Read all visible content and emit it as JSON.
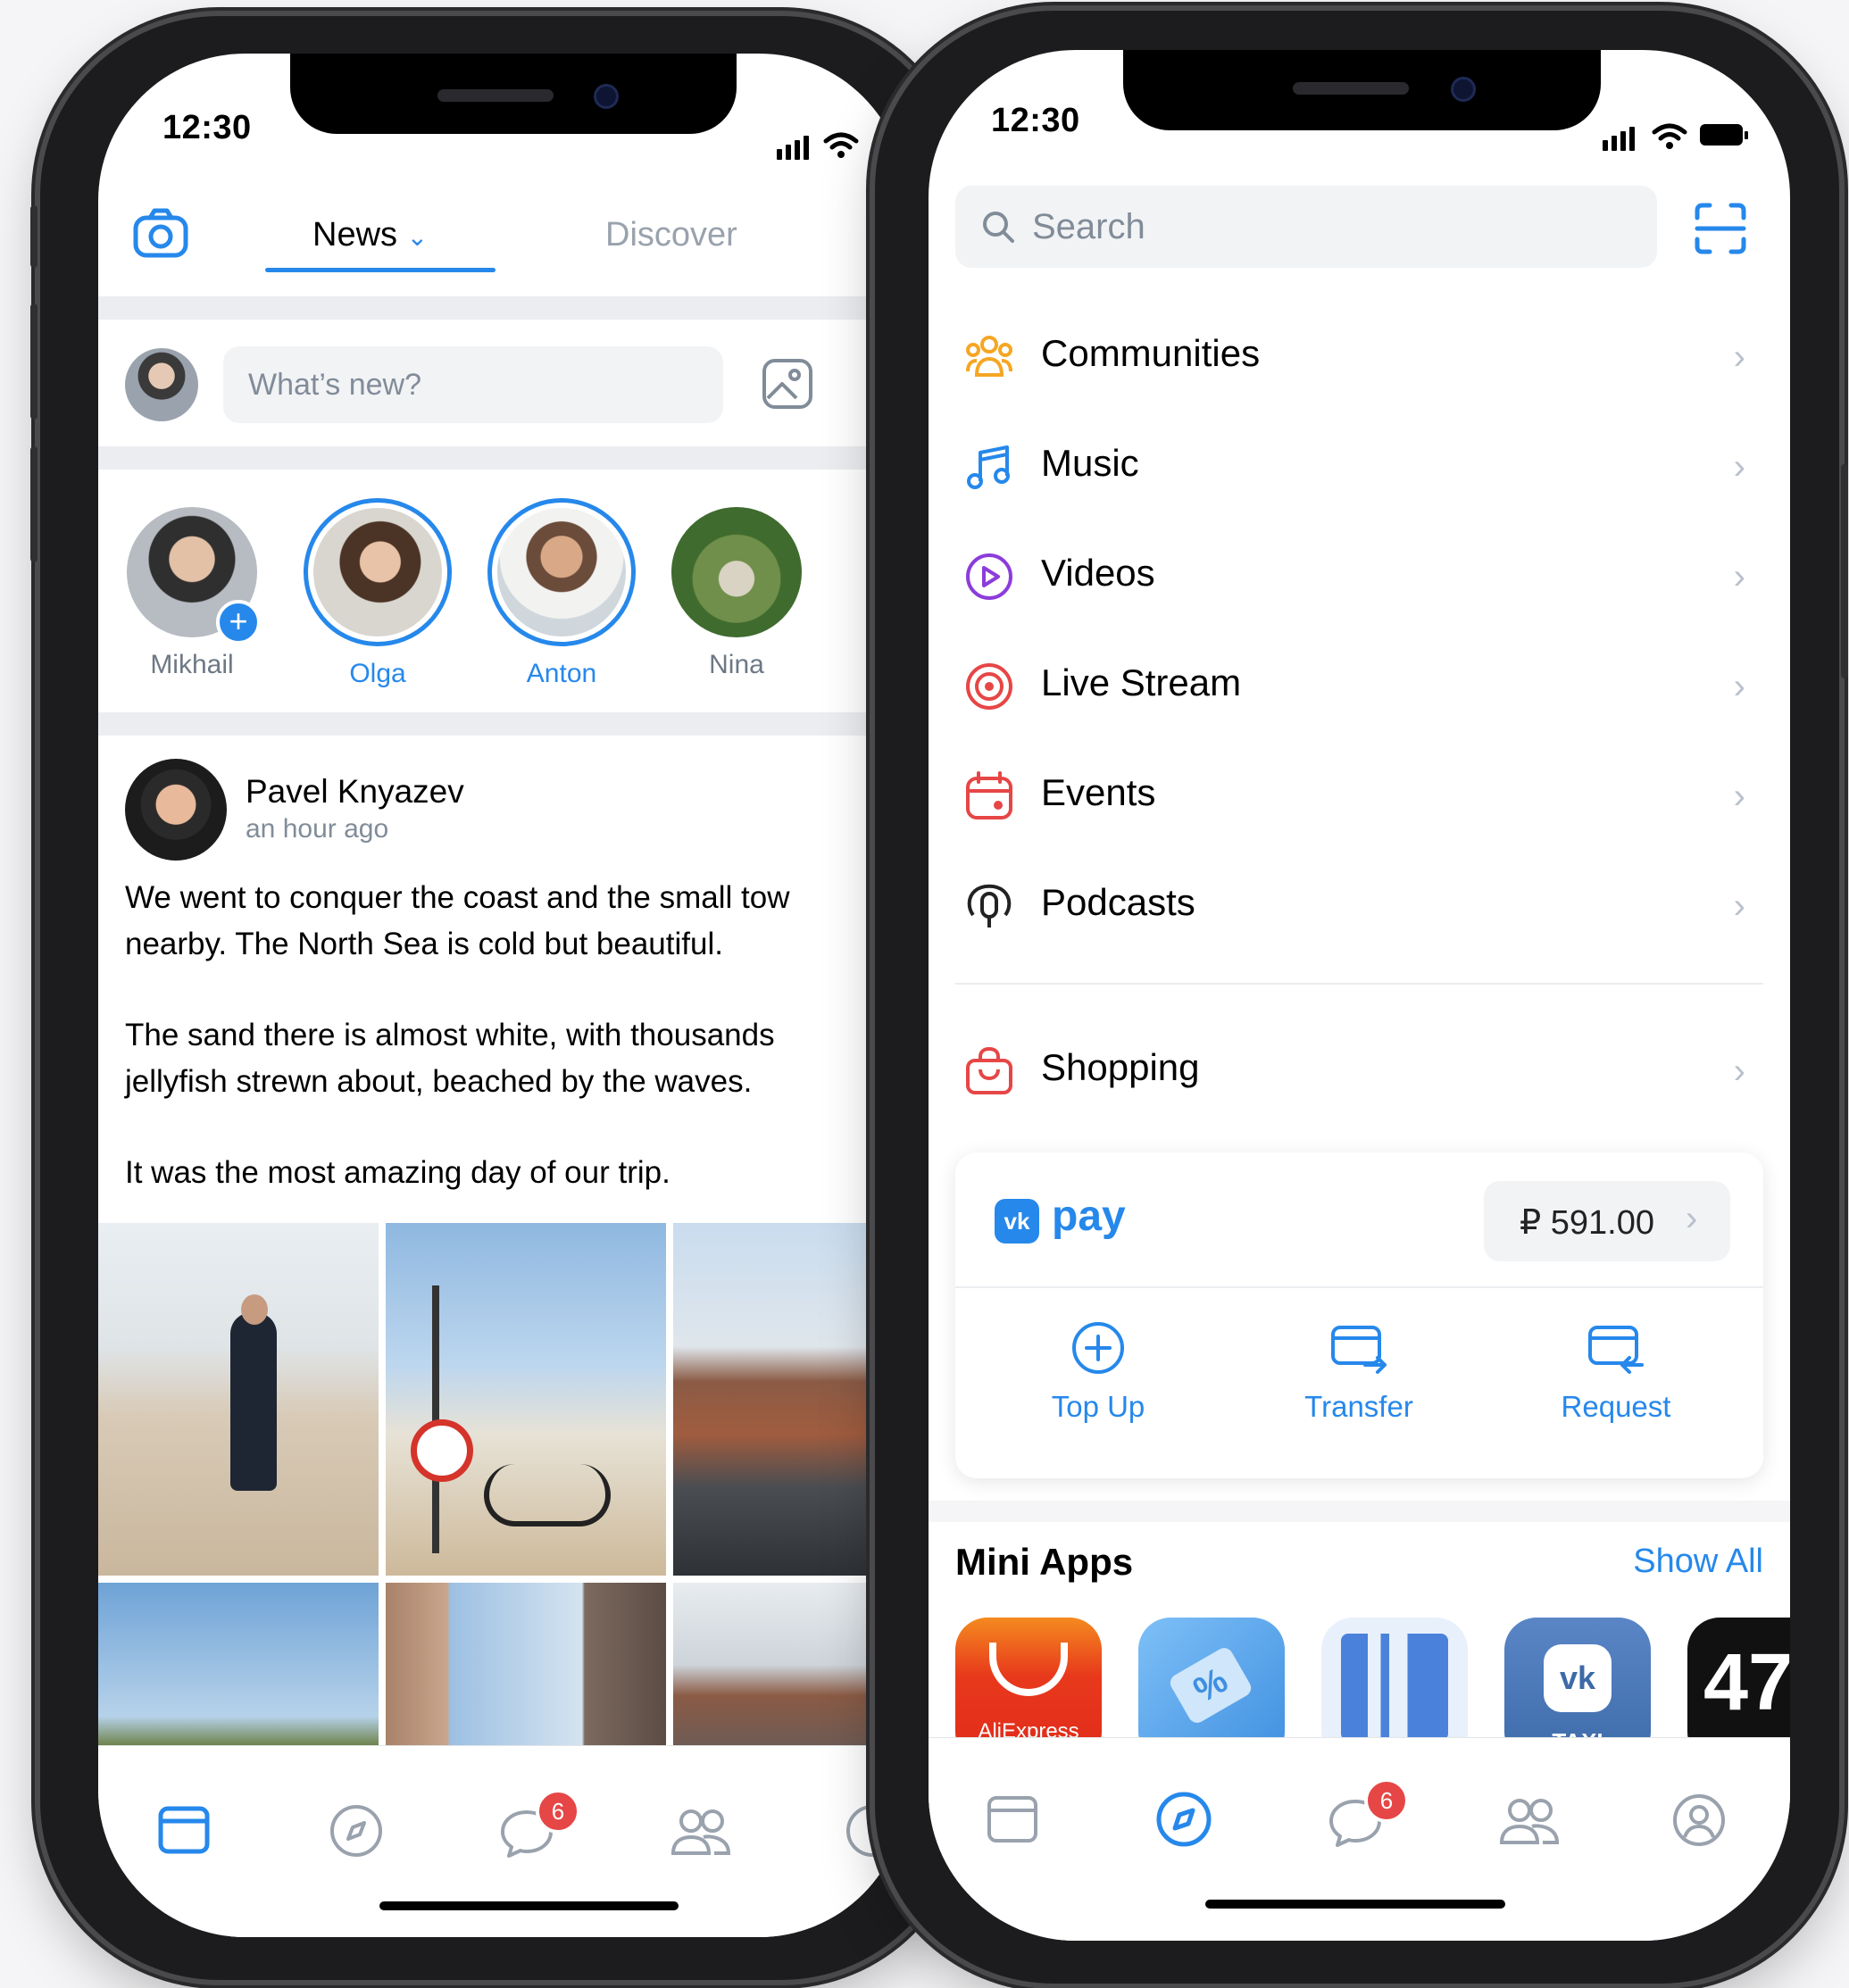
{
  "left_phone": {
    "status": {
      "time": "12:30"
    },
    "header": {
      "tab_news": "News",
      "tab_discover": "Discover"
    },
    "composer": {
      "placeholder": "What’s new?"
    },
    "stories": [
      {
        "name": "Mikhail"
      },
      {
        "name": "Olga"
      },
      {
        "name": "Anton"
      },
      {
        "name": "Nina"
      }
    ],
    "post": {
      "author": "Pavel Knyazev",
      "time": "an hour ago",
      "lines": [
        "We went to conquer the coast and the small tow",
        "nearby. The North Sea is cold but beautiful.",
        "",
        "The sand there is almost white, with thousands",
        "jellyfish strewn about, beached by the waves.",
        "",
        "It was the most amazing day of our trip."
      ]
    },
    "tabbar": {
      "messages_badge": "6"
    }
  },
  "right_phone": {
    "status": {
      "time": "12:30"
    },
    "search": {
      "placeholder": "Search"
    },
    "menu": [
      {
        "label": "Communities",
        "icon": "communities-icon",
        "color": "#f5a623"
      },
      {
        "label": "Music",
        "icon": "music-icon",
        "color": "#2688eb"
      },
      {
        "label": "Videos",
        "icon": "videos-icon",
        "color": "#8c3cdb"
      },
      {
        "label": "Live Stream",
        "icon": "live-stream-icon",
        "color": "#e64646"
      },
      {
        "label": "Events",
        "icon": "events-icon",
        "color": "#e64646"
      },
      {
        "label": "Podcasts",
        "icon": "podcasts-icon",
        "color": "#222222"
      },
      {
        "label": "Shopping",
        "icon": "shopping-icon",
        "color": "#e64646"
      }
    ],
    "pay": {
      "brand": "pay",
      "balance": "₽ 591.00",
      "actions": [
        {
          "label": "Top Up"
        },
        {
          "label": "Transfer"
        },
        {
          "label": "Request"
        }
      ]
    },
    "mini_apps": {
      "title": "Mini Apps",
      "show_all": "Show All",
      "apps": [
        {
          "label": "AliExpress",
          "color": "#e8391c"
        },
        {
          "label": "",
          "color": "#5aa7f2"
        },
        {
          "label": "",
          "color": "#e8f0fb"
        },
        {
          "label": "TAXI",
          "color": "#4a76b8"
        },
        {
          "label": "47",
          "color": "#111111"
        }
      ]
    },
    "tabbar": {
      "messages_badge": "6"
    }
  },
  "colors": {
    "accent": "#2688eb",
    "secondary_text": "#818c99",
    "badge": "#e64646"
  }
}
